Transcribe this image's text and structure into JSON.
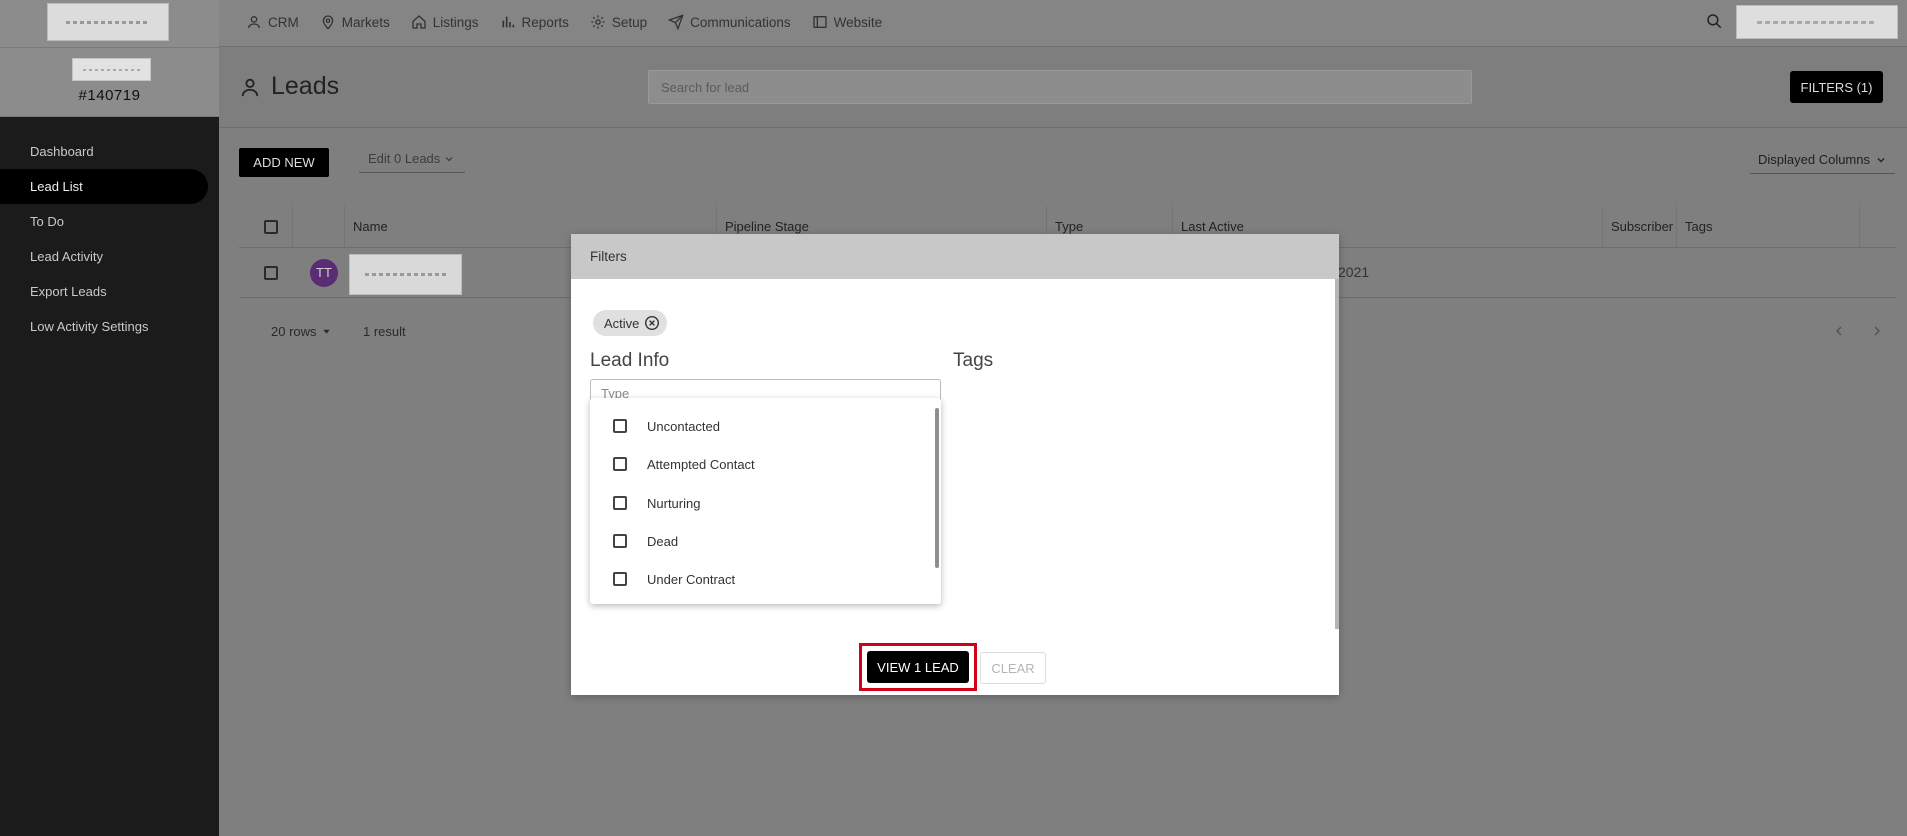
{
  "sidebar": {
    "account_id": "#140719",
    "items": [
      {
        "label": "Dashboard"
      },
      {
        "label": "Lead List"
      },
      {
        "label": "To Do"
      },
      {
        "label": "Lead Activity"
      },
      {
        "label": "Export Leads"
      },
      {
        "label": "Low Activity Settings"
      }
    ],
    "active_index": 1
  },
  "topnav": {
    "items": [
      {
        "label": "CRM",
        "icon": "person-icon"
      },
      {
        "label": "Markets",
        "icon": "map-pin-icon"
      },
      {
        "label": "Listings",
        "icon": "home-icon"
      },
      {
        "label": "Reports",
        "icon": "bar-chart-icon"
      },
      {
        "label": "Setup",
        "icon": "gear-icon"
      },
      {
        "label": "Communications",
        "icon": "send-icon"
      },
      {
        "label": "Website",
        "icon": "browser-window-icon"
      }
    ]
  },
  "header": {
    "title": "Leads",
    "search_placeholder": "Search for lead",
    "filters_label": "FILTERS (1)"
  },
  "toolbar": {
    "add_new_label": "ADD NEW",
    "edit_label": "Edit 0 Leads",
    "displayed_columns_label": "Displayed Columns"
  },
  "table": {
    "columns": [
      "Name",
      "Pipeline Stage",
      "Type",
      "Last Active",
      "Subscriber",
      "Tags"
    ],
    "rows": [
      {
        "initials": "TT",
        "last_active_partial": "2021"
      }
    ]
  },
  "pagination": {
    "rows_label": "20 rows",
    "result_label": "1 result"
  },
  "modal": {
    "title": "Filters",
    "chip_label": "Active",
    "lead_info_title": "Lead Info",
    "tags_title": "Tags",
    "type_placeholder": "Type",
    "options": [
      {
        "label": "Uncontacted",
        "checked": false
      },
      {
        "label": "Attempted Contact",
        "checked": false
      },
      {
        "label": "Nurturing",
        "checked": false
      },
      {
        "label": "Dead",
        "checked": false
      },
      {
        "label": "Under Contract",
        "checked": false
      }
    ],
    "view_label": "VIEW 1 LEAD",
    "clear_label": "CLEAR"
  },
  "colors": {
    "accent": "#000000",
    "highlight_border": "#d0021b",
    "avatar": "#5a2c73"
  }
}
